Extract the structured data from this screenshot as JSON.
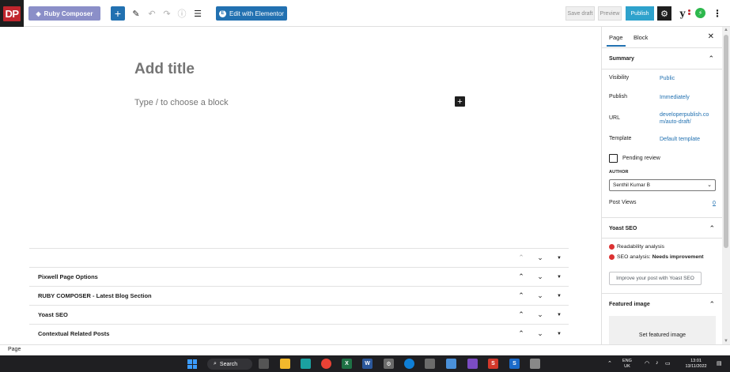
{
  "toolbar": {
    "logo_text": "DP",
    "ruby_composer_label": "Ruby Composer",
    "elementor_label": "Edit with Elementor",
    "save_draft_label": "Save draft",
    "preview_label": "Preview",
    "publish_label": "Publish",
    "accent_color": "#2271b1"
  },
  "editor": {
    "title_placeholder": "Add title",
    "block_placeholder": "Type / to choose a block"
  },
  "metaboxes": [
    {
      "title": ""
    },
    {
      "title": "Pixwell Page Options"
    },
    {
      "title": "RUBY COMPOSER - Latest Blog Section"
    },
    {
      "title": "Yoast SEO"
    },
    {
      "title": "Contextual Related Posts"
    }
  ],
  "sidebar": {
    "tabs": [
      {
        "label": "Page",
        "active": true
      },
      {
        "label": "Block",
        "active": false
      }
    ],
    "summary": {
      "heading": "Summary",
      "visibility_label": "Visibility",
      "visibility_value": "Public",
      "publish_label": "Publish",
      "publish_value": "Immediately",
      "url_label": "URL",
      "url_value_line1": "developerpublish.co",
      "url_value_line2": "m/auto-draft/",
      "template_label": "Template",
      "template_value": "Default template",
      "pending_review_label": "Pending review",
      "author_heading": "AUTHOR",
      "author_value": "Senthil Kumar B",
      "post_views_label": "Post Views",
      "post_views_value": "0"
    },
    "yoast": {
      "heading": "Yoast SEO",
      "readability_label": "Readability analysis",
      "seo_label": "SEO analysis:",
      "seo_value": "Needs improvement",
      "improve_button": "Improve your post with Yoast SEO",
      "status_color": "#dc3232"
    },
    "featured": {
      "heading": "Featured image",
      "button": "Set featured image"
    }
  },
  "status": {
    "breadcrumb": "Page"
  },
  "taskbar": {
    "search_label": "Search",
    "lang_line1": "ENG",
    "lang_line2": "UK",
    "time": "13:01",
    "date": "13/11/2022"
  }
}
